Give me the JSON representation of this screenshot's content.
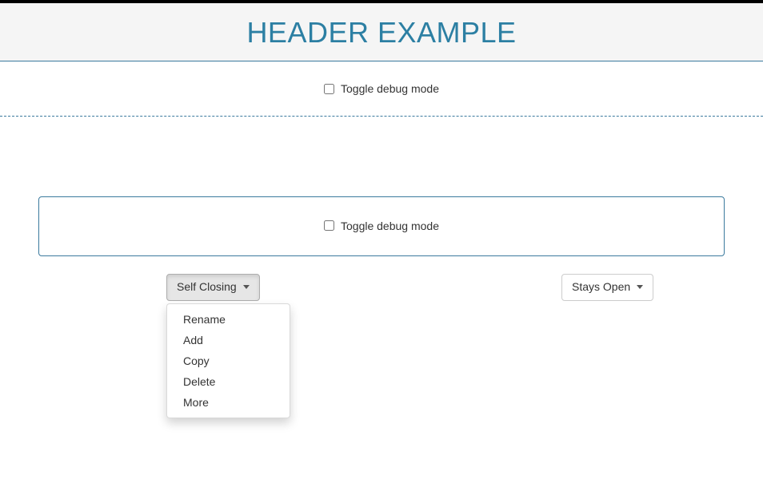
{
  "header": {
    "title": "HEADER EXAMPLE"
  },
  "toggle": {
    "label": "Toggle debug mode"
  },
  "buttons": {
    "self_closing": "Self Closing",
    "stays_open": "Stays Open"
  },
  "dropdown": {
    "items": [
      "Rename",
      "Add",
      "Copy",
      "Delete",
      "More"
    ]
  }
}
